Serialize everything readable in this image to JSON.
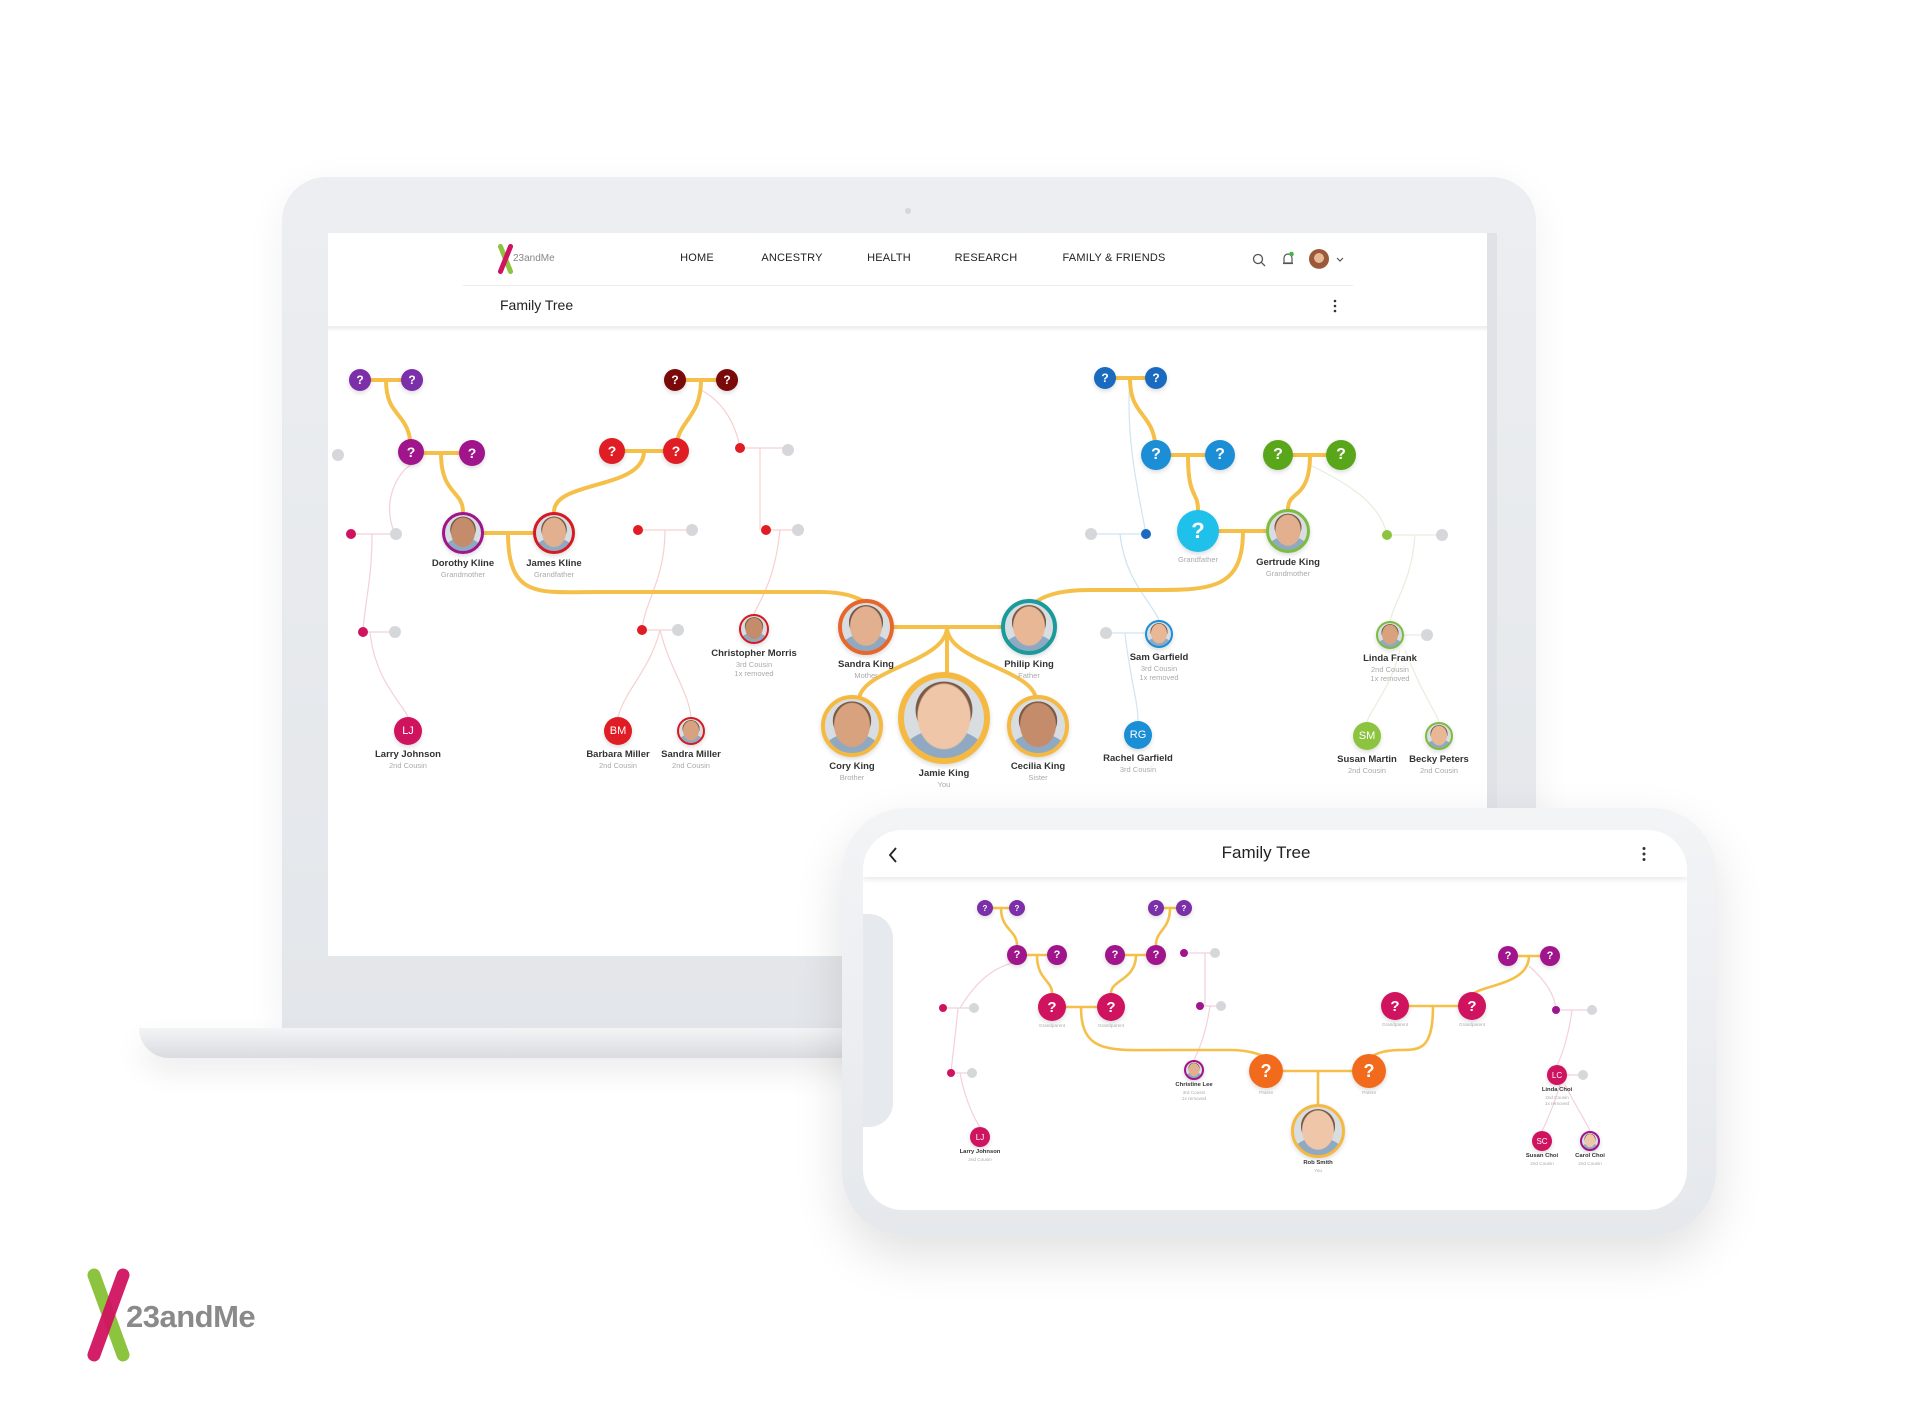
{
  "brand": {
    "name": "23andMe",
    "green": "#8cc43f",
    "magenta": "#d0135f"
  },
  "colors": {
    "line": "#f5c04a",
    "gray_dot": "#d5d7da"
  },
  "laptop": {
    "nav": {
      "logo_text": "23andMe",
      "items": [
        "HOME",
        "ANCESTRY",
        "HEALTH",
        "RESEARCH",
        "FAMILY & FRIENDS"
      ],
      "icons": [
        "search-icon",
        "bell-icon",
        "avatar",
        "chevron-down-icon"
      ],
      "notification_color": "#4caf50"
    },
    "page_title": "Family Tree",
    "menu_icon": "kebab-menu-icon",
    "nodes": [
      {
        "type": "unknown",
        "color": "#7b2fa8",
        "label": "?"
      },
      {
        "type": "unknown",
        "color": "#7b2fa8",
        "label": "?"
      },
      {
        "type": "unknown",
        "color": "#a0158c",
        "label": "?"
      },
      {
        "type": "unknown",
        "color": "#a0158c",
        "label": "?"
      },
      {
        "type": "dot",
        "color": "#d5d7da"
      },
      {
        "type": "unknown",
        "color": "#7a0a0a",
        "label": "?"
      },
      {
        "type": "unknown",
        "color": "#7a0a0a",
        "label": "?"
      },
      {
        "type": "unknown",
        "color": "#e01c24",
        "label": "?"
      },
      {
        "type": "unknown",
        "color": "#e01c24",
        "label": "?"
      },
      {
        "type": "dot",
        "color": "#e01c24"
      },
      {
        "type": "dot",
        "color": "#d5d7da"
      },
      {
        "type": "dot",
        "color": "#d0135f"
      },
      {
        "type": "dot",
        "color": "#d5d7da"
      },
      {
        "type": "photo",
        "color": "#a0158c",
        "name": "Dorothy Kline",
        "relation": "Grandmother"
      },
      {
        "type": "photo",
        "color": "#d51a23",
        "name": "James Kline",
        "relation": "Grandfather"
      },
      {
        "type": "dot",
        "color": "#e01c24"
      },
      {
        "type": "dot",
        "color": "#d5d7da"
      },
      {
        "type": "dot",
        "color": "#e01c24"
      },
      {
        "type": "dot",
        "color": "#d5d7da"
      },
      {
        "type": "dot",
        "color": "#d0135f"
      },
      {
        "type": "dot",
        "color": "#d5d7da"
      },
      {
        "type": "dot",
        "color": "#e01c24"
      },
      {
        "type": "dot",
        "color": "#d5d7da"
      },
      {
        "type": "photo",
        "color": "#d51a23",
        "name": "Christopher Morris",
        "relation": "3rd Cousin",
        "relation2": "1x removed"
      },
      {
        "type": "photo",
        "color": "#e8662a",
        "name": "Sandra King",
        "relation": "Mother"
      },
      {
        "type": "photo",
        "color": "#1a9a9a",
        "name": "Philip King",
        "relation": "Father"
      },
      {
        "type": "photo",
        "color": "#f5b942",
        "name": "Cory King",
        "relation": "Brother"
      },
      {
        "type": "photo",
        "color": "#f5b942",
        "name": "Jamie King",
        "relation": "You"
      },
      {
        "type": "photo",
        "color": "#f5b942",
        "name": "Cecilia King",
        "relation": "Sister"
      },
      {
        "type": "initials",
        "color": "#d0135f",
        "label": "LJ",
        "name": "Larry Johnson",
        "relation": "2nd Cousin"
      },
      {
        "type": "initials",
        "color": "#e01c24",
        "label": "BM",
        "name": "Barbara Miller",
        "relation": "2nd Cousin"
      },
      {
        "type": "photo",
        "color": "#d51a23",
        "name": "Sandra Miller",
        "relation": "2nd Cousin"
      },
      {
        "type": "unknown",
        "color": "#1a6bc0",
        "label": "?"
      },
      {
        "type": "unknown",
        "color": "#1a6bc0",
        "label": "?"
      },
      {
        "type": "unknown",
        "color": "#1c8ed6",
        "label": "?"
      },
      {
        "type": "unknown",
        "color": "#1c8ed6",
        "label": "?"
      },
      {
        "type": "unknown",
        "color": "#5aa61a",
        "label": "?"
      },
      {
        "type": "unknown",
        "color": "#5aa61a",
        "label": "?"
      },
      {
        "type": "unknown",
        "color": "#1fc0ea",
        "label": "?",
        "relation": "Grandfather"
      },
      {
        "type": "photo",
        "color": "#7cbc3f",
        "name": "Gertrude King",
        "relation": "Grandmother"
      },
      {
        "type": "dot",
        "color": "#d5d7da"
      },
      {
        "type": "dot",
        "color": "#1a6bc0"
      },
      {
        "type": "dot",
        "color": "#8cc43f"
      },
      {
        "type": "dot",
        "color": "#d5d7da"
      },
      {
        "type": "dot",
        "color": "#d5d7da"
      },
      {
        "type": "photo",
        "color": "#1a8fd6",
        "name": "Sam Garfield",
        "relation": "3rd Cousin",
        "relation2": "1x removed"
      },
      {
        "type": "photo",
        "color": "#7cbc3f",
        "name": "Linda Frank",
        "relation": "2nd Cousin",
        "relation2": "1x removed"
      },
      {
        "type": "dot",
        "color": "#d5d7da"
      },
      {
        "type": "initials",
        "color": "#1a8fd6",
        "label": "RG",
        "name": "Rachel Garfield",
        "relation": "3rd Cousin"
      },
      {
        "type": "initials",
        "color": "#8cc43f",
        "label": "SM",
        "name": "Susan Martin",
        "relation": "2nd Cousin"
      },
      {
        "type": "photo",
        "color": "#7cbc3f",
        "name": "Becky Peters",
        "relation": "2nd Cousin"
      }
    ]
  },
  "phone": {
    "title": "Family Tree",
    "back_icon": "chevron-left-icon",
    "menu_icon": "kebab-menu-icon",
    "nodes": [
      {
        "type": "unknown",
        "color": "#7b2fa8",
        "label": "?"
      },
      {
        "type": "unknown",
        "color": "#7b2fa8",
        "label": "?"
      },
      {
        "type": "unknown",
        "color": "#7b2fa8",
        "label": "?"
      },
      {
        "type": "unknown",
        "color": "#7b2fa8",
        "label": "?"
      },
      {
        "type": "unknown",
        "color": "#a0158c",
        "label": "?"
      },
      {
        "type": "unknown",
        "color": "#a0158c",
        "label": "?"
      },
      {
        "type": "unknown",
        "color": "#a0158c",
        "label": "?"
      },
      {
        "type": "unknown",
        "color": "#a0158c",
        "label": "?"
      },
      {
        "type": "dot",
        "color": "#a0158c"
      },
      {
        "type": "dot",
        "color": "#d5d7da"
      },
      {
        "type": "unknown",
        "color": "#d0135f",
        "label": "?",
        "relation": "Grandparent"
      },
      {
        "type": "unknown",
        "color": "#d0135f",
        "label": "?",
        "relation": "Grandparent"
      },
      {
        "type": "unknown",
        "color": "#d0135f",
        "label": "?",
        "relation": "Grandparent"
      },
      {
        "type": "unknown",
        "color": "#d0135f",
        "label": "?",
        "relation": "Grandparent"
      },
      {
        "type": "unknown",
        "color": "#a0158c",
        "label": "?"
      },
      {
        "type": "unknown",
        "color": "#a0158c",
        "label": "?"
      },
      {
        "type": "dot",
        "color": "#d0135f"
      },
      {
        "type": "dot",
        "color": "#d5d7da"
      },
      {
        "type": "dot",
        "color": "#a0158c"
      },
      {
        "type": "dot",
        "color": "#d5d7da"
      },
      {
        "type": "dot",
        "color": "#a0158c"
      },
      {
        "type": "dot",
        "color": "#d5d7da"
      },
      {
        "type": "dot",
        "color": "#d0135f"
      },
      {
        "type": "dot",
        "color": "#d5d7da"
      },
      {
        "type": "photo",
        "color": "#a0158c",
        "name": "Christine Lee",
        "relation": "3rd Cousin",
        "relation2": "1x removed"
      },
      {
        "type": "unknown",
        "color": "#f26b1d",
        "label": "?",
        "relation": "Parent"
      },
      {
        "type": "unknown",
        "color": "#f26b1d",
        "label": "?",
        "relation": "Parent"
      },
      {
        "type": "photo",
        "color": "#f5b942",
        "name": "Rob Smith",
        "relation": "You"
      },
      {
        "type": "initials",
        "color": "#d0135f",
        "label": "LJ",
        "name": "Larry Johnson",
        "relation": "2nd Cousin"
      },
      {
        "type": "initials",
        "color": "#d0135f",
        "label": "LC",
        "name": "Linda Choi",
        "relation": "2nd Cousin",
        "relation2": "1x removed"
      },
      {
        "type": "dot",
        "color": "#d5d7da"
      },
      {
        "type": "initials",
        "color": "#d0135f",
        "label": "SC",
        "name": "Susan Choi",
        "relation": "2nd Cousin"
      },
      {
        "type": "photo",
        "color": "#a0158c",
        "name": "Carol Choi",
        "relation": "2nd Cousin"
      }
    ]
  },
  "footer_logo": {
    "text": "23andMe"
  }
}
